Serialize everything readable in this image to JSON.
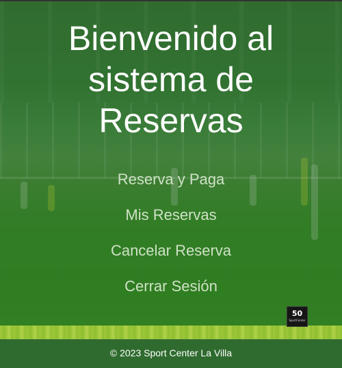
{
  "header": {
    "title": "Bienvenido al sistema de Reservas"
  },
  "menu": {
    "items": [
      {
        "label": "Reserva y Paga"
      },
      {
        "label": "Mis Reservas"
      },
      {
        "label": "Cancelar Reserva"
      },
      {
        "label": "Cerrar Sesión"
      }
    ]
  },
  "logo": {
    "number": "50",
    "text": "SportCenter"
  },
  "footer": {
    "text": "© 2023 Sport Center La Villa"
  },
  "colors": {
    "background_green": "#2f6b2f",
    "menu_text": "#cfe2c6",
    "title_text": "#ffffff"
  }
}
